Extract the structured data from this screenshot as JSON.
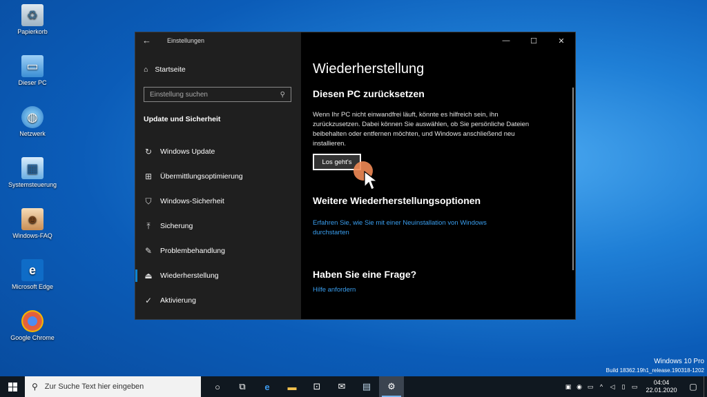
{
  "desktop": {
    "icons": [
      {
        "label": "Papierkorb",
        "icon": "recycle-bin-icon"
      },
      {
        "label": "Dieser PC",
        "icon": "computer-icon"
      },
      {
        "label": "Netzwerk",
        "icon": "network-icon"
      },
      {
        "label": "Systemsteuerung",
        "icon": "control-panel-icon"
      },
      {
        "label": "Windows-FAQ",
        "icon": "user-folder-icon"
      },
      {
        "label": "Microsoft Edge",
        "icon": "edge-icon"
      },
      {
        "label": "Google Chrome",
        "icon": "chrome-icon"
      }
    ]
  },
  "window": {
    "title": "Einstellungen",
    "controls": {
      "minimize": "—",
      "maximize": "☐",
      "close": "✕"
    }
  },
  "sidebar": {
    "home_label": "Startseite",
    "search_placeholder": "Einstellung suchen",
    "section_title": "Update und Sicherheit",
    "items": [
      {
        "label": "Windows Update",
        "icon": "refresh-icon",
        "active": false
      },
      {
        "label": "Übermittlungsoptimierung",
        "icon": "delivery-icon",
        "active": false
      },
      {
        "label": "Windows-Sicherheit",
        "icon": "shield-icon",
        "active": false
      },
      {
        "label": "Sicherung",
        "icon": "backup-arrow-icon",
        "active": false
      },
      {
        "label": "Problembehandlung",
        "icon": "wrench-icon",
        "active": false
      },
      {
        "label": "Wiederherstellung",
        "icon": "recovery-icon",
        "active": true
      },
      {
        "label": "Aktivierung",
        "icon": "check-circle-icon",
        "active": false
      }
    ]
  },
  "main": {
    "title": "Wiederherstellung",
    "reset_heading": "Diesen PC zurücksetzen",
    "reset_description": "Wenn Ihr PC nicht einwandfrei läuft, könnte es hilfreich sein, ihn zurückzusetzen. Dabei können Sie auswählen, ob Sie persönliche Dateien beibehalten oder entfernen möchten, und Windows anschließend neu installieren.",
    "reset_button": "Los geht's",
    "more_heading": "Weitere Wiederherstellungsoptionen",
    "more_link": "Erfahren Sie, wie Sie mit einer Neuinstallation von Windows durchstarten",
    "question_heading": "Haben Sie eine Frage?",
    "help_link": "Hilfe anfordern"
  },
  "watermark": {
    "line1": "Windows 10 Pro",
    "line2": "Build 18362.19h1_release.190318-1202"
  },
  "taskbar": {
    "search_placeholder": "Zur Suche Text hier eingeben",
    "clock_time": "04:04",
    "clock_date": "22.01.2020",
    "apps": [
      "cortana-icon",
      "task-view-icon",
      "edge-icon",
      "explorer-icon",
      "store-icon",
      "mail-icon",
      "notepad-icon",
      "settings-gear-icon"
    ]
  },
  "colors": {
    "accent": "#0a84d6",
    "link": "#3a9ff0",
    "window_bg": "#000000",
    "sidebar_bg": "#1f1f1f",
    "taskbar_bg": "#101820"
  }
}
